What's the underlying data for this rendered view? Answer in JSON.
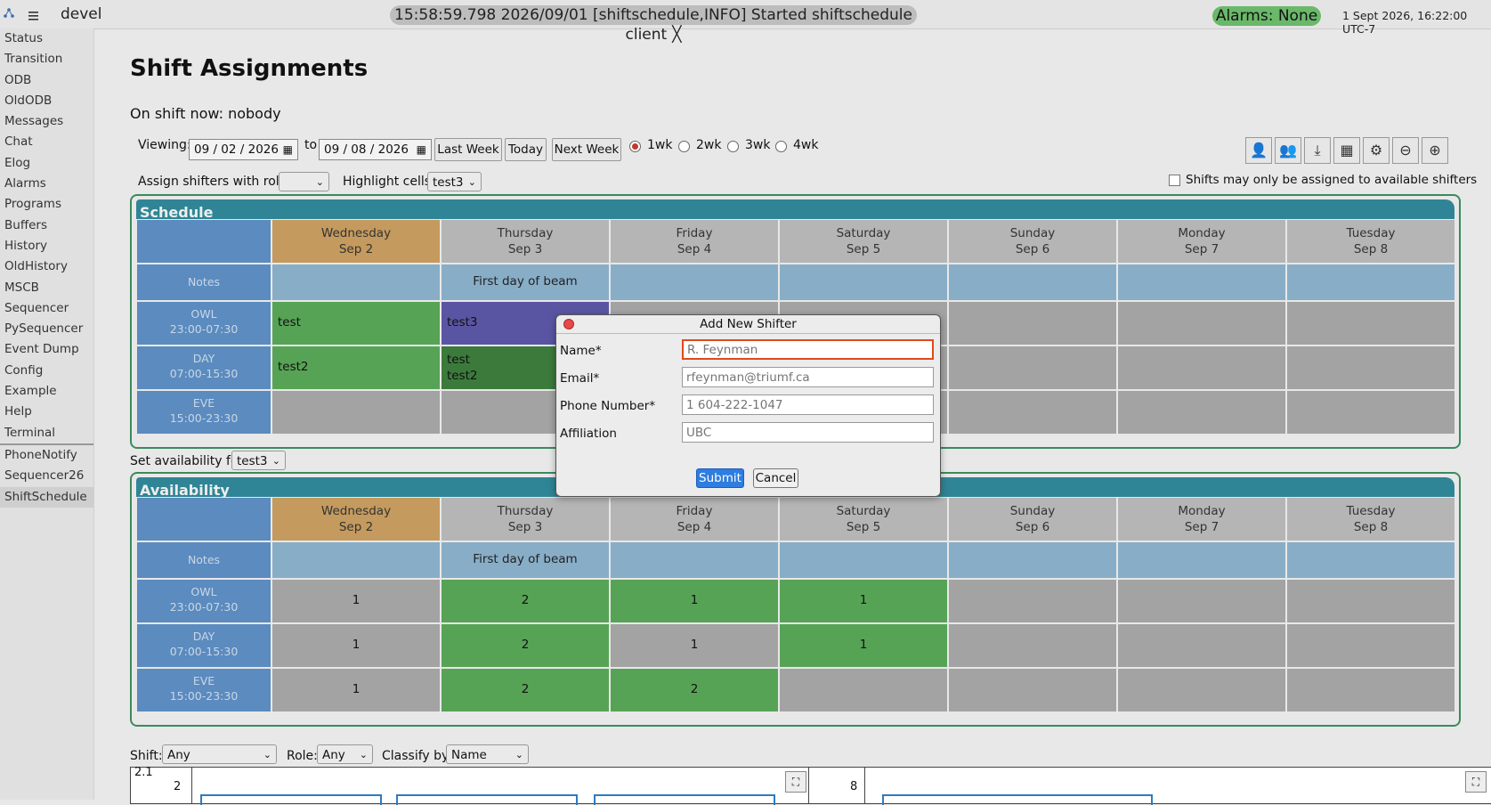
{
  "topbar": {
    "experiment": "devel",
    "message": "15:58:59.798 2026/09/01 [shiftschedule,INFO] Started shiftschedule client",
    "message_close": "╳",
    "alarms": "Alarms: None",
    "clock": "1 Sept 2026, 16:22:00 UTC-7"
  },
  "sidebar": {
    "items": [
      "Status",
      "Transition",
      "ODB",
      "OldODB",
      "Messages",
      "Chat",
      "Elog",
      "Alarms",
      "Programs",
      "Buffers",
      "History",
      "OldHistory",
      "MSCB",
      "Sequencer",
      "PySequencer",
      "Event Dump",
      "Config",
      "Example",
      "Help",
      "Terminal"
    ],
    "custom": [
      "PhoneNotify",
      "Sequencer26",
      "ShiftSchedule"
    ]
  },
  "page": {
    "title": "Shift Assignments",
    "on_shift": "On shift now: nobody"
  },
  "controls": {
    "viewing_label": "Viewing:",
    "from_date": "09 / 02 / 2026",
    "to_label": "to",
    "to_date": "09 / 08 / 2026",
    "last_week": "Last Week",
    "today": "Today",
    "next_week": "Next Week",
    "ranges": [
      "1wk",
      "2wk",
      "3wk",
      "4wk"
    ],
    "assign_label": "Assign shifters with role:",
    "assign_value": "",
    "highlight_label": "Highlight cells:",
    "highlight_value": "test3",
    "available_only": "Shifts may only be assigned to available shifters",
    "set_avail_label": "Set availability for",
    "set_avail_value": "test3"
  },
  "days": [
    {
      "name": "Wednesday",
      "date": "Sep 2"
    },
    {
      "name": "Thursday",
      "date": "Sep 3"
    },
    {
      "name": "Friday",
      "date": "Sep 4"
    },
    {
      "name": "Saturday",
      "date": "Sep 5"
    },
    {
      "name": "Sunday",
      "date": "Sep 6"
    },
    {
      "name": "Monday",
      "date": "Sep 7"
    },
    {
      "name": "Tuesday",
      "date": "Sep 8"
    }
  ],
  "shifts": [
    {
      "name": "OWL",
      "time": "23:00-07:30"
    },
    {
      "name": "DAY",
      "time": "07:00-15:30"
    },
    {
      "name": "EVE",
      "time": "15:00-23:30"
    }
  ],
  "notes_label": "Notes",
  "notes_text": "First day of beam",
  "schedule": {
    "title": "Schedule",
    "cells": [
      [
        {
          "text": "test",
          "color": "green"
        },
        {
          "text": "test3",
          "color": "purple"
        },
        {
          "text": "",
          "color": "gray"
        },
        {
          "text": "",
          "color": "gray"
        },
        {
          "text": "",
          "color": "gray"
        },
        {
          "text": "",
          "color": "gray"
        },
        {
          "text": "",
          "color": "gray"
        }
      ],
      [
        {
          "text": "test2",
          "color": "green"
        },
        {
          "text": "test\ntest2",
          "color": "dgreen"
        },
        {
          "text": "",
          "color": "gray"
        },
        {
          "text": "",
          "color": "gray"
        },
        {
          "text": "",
          "color": "gray"
        },
        {
          "text": "",
          "color": "gray"
        },
        {
          "text": "",
          "color": "gray"
        }
      ],
      [
        {
          "text": "",
          "color": "gray"
        },
        {
          "text": "",
          "color": "gray"
        },
        {
          "text": "",
          "color": "gray"
        },
        {
          "text": "",
          "color": "gray"
        },
        {
          "text": "",
          "color": "gray"
        },
        {
          "text": "",
          "color": "gray"
        },
        {
          "text": "",
          "color": "gray"
        }
      ]
    ]
  },
  "availability": {
    "title": "Availability",
    "cells": [
      [
        {
          "text": "1",
          "color": "gray"
        },
        {
          "text": "2",
          "color": "green"
        },
        {
          "text": "1",
          "color": "green"
        },
        {
          "text": "1",
          "color": "green"
        },
        {
          "text": "",
          "color": "gray"
        },
        {
          "text": "",
          "color": "gray"
        },
        {
          "text": "",
          "color": "gray"
        }
      ],
      [
        {
          "text": "1",
          "color": "gray"
        },
        {
          "text": "2",
          "color": "green"
        },
        {
          "text": "1",
          "color": "gray"
        },
        {
          "text": "1",
          "color": "green"
        },
        {
          "text": "",
          "color": "gray"
        },
        {
          "text": "",
          "color": "gray"
        },
        {
          "text": "",
          "color": "gray"
        }
      ],
      [
        {
          "text": "1",
          "color": "gray"
        },
        {
          "text": "2",
          "color": "green"
        },
        {
          "text": "2",
          "color": "green"
        },
        {
          "text": "",
          "color": "gray"
        },
        {
          "text": "",
          "color": "gray"
        },
        {
          "text": "",
          "color": "gray"
        },
        {
          "text": "",
          "color": "gray"
        }
      ]
    ]
  },
  "filters": {
    "shift_label": "Shift:",
    "shift_value": "Any",
    "role_label": "Role:",
    "role_value": "Any",
    "classify_label": "Classify by:",
    "classify_value": "Name"
  },
  "charts": {
    "left_ticks": [
      "2.1",
      "2"
    ],
    "right_ticks": [
      "8"
    ]
  },
  "modal": {
    "title": "Add New Shifter",
    "name_label": "Name*",
    "name_placeholder": "R. Feynman",
    "email_label": "Email*",
    "email_placeholder": "rfeynman@triumf.ca",
    "phone_label": "Phone Number*",
    "phone_placeholder": "1 604-222-1047",
    "affiliation_label": "Affiliation",
    "affiliation_placeholder": "UBC",
    "submit": "Submit",
    "cancel": "Cancel"
  },
  "colors": {
    "green": "#57a356",
    "dgreen": "#3c7a3c",
    "purple": "#5a55a3",
    "gray": "#a3a3a3",
    "today": "#c49a5e",
    "header_blue": "#5b8bbf",
    "panel_teal": "#2f8595"
  }
}
